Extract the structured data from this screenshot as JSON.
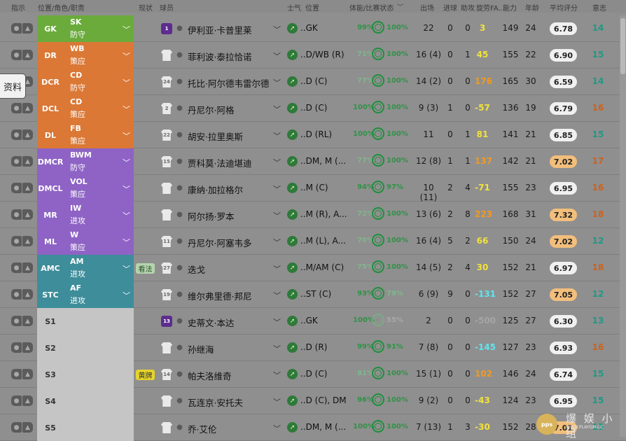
{
  "header": {
    "instruction": "指示",
    "position_role_duty": "位置/角色/职责",
    "status": "现状",
    "player": "球员",
    "morale": "士气",
    "position": "位置",
    "condition_sharpness": "体能/比赛状态",
    "apps": "出场",
    "goals": "进球",
    "assists": "助攻",
    "pom": "旋劳FA...",
    "ability": "能力",
    "age": "年龄",
    "avg_rating": "平均评分",
    "intent": "意志"
  },
  "side_button": "资料",
  "colors": {
    "gk": "#6aab3c",
    "defence": "#db7835",
    "midfield": "#8e63c5",
    "attack": "#3d8d9a",
    "sub": "#c5c5c5",
    "green_condition": "#2f9346",
    "orange": "#f09a23",
    "yellow": "#f2e23b",
    "cyan": "#5fe6f2",
    "intent_teal": "#1c9a86",
    "intent_orange": "#d0611a"
  },
  "rows": [
    {
      "pos": "GK",
      "role": "SK",
      "duty": "防守",
      "group": "gk",
      "tag": "",
      "shirt": "1",
      "shirt_style": "purple",
      "name": "伊利亚·卡普里莱",
      "mpos": "..GK",
      "cond": "99%",
      "cond_color": "green",
      "sharp": "100%",
      "sharp_color": "green",
      "apps": "22",
      "goals": "0",
      "assists": "0",
      "pom": "3",
      "pom_color": "yellow",
      "ability": "149",
      "age": "24",
      "rating": "6.78",
      "rating_hi": false,
      "intent": "14",
      "intent_color": "teal"
    },
    {
      "pos": "DR",
      "role": "WB",
      "duty": "策应",
      "group": "defence",
      "tag": "",
      "shirt": "",
      "shirt_style": "white",
      "name": "菲利波·泰拉恰诺",
      "mpos": "..D/WB (R)",
      "cond": "71%",
      "cond_color": "green-light",
      "sharp": "100%",
      "sharp_color": "green",
      "apps": "16 (4)",
      "goals": "0",
      "assists": "1",
      "pom": "45",
      "pom_color": "yellow",
      "ability": "155",
      "age": "22",
      "rating": "6.90",
      "rating_hi": false,
      "intent": "15",
      "intent_color": "teal"
    },
    {
      "pos": "DCR",
      "role": "CD",
      "duty": "防守",
      "group": "defence",
      "tag": "",
      "shirt": "24",
      "shirt_style": "white",
      "name": "托比·阿尔德韦雷尔德",
      "mpos": "..D (C)",
      "cond": "77%",
      "cond_color": "green-light",
      "sharp": "100%",
      "sharp_color": "green",
      "apps": "14 (2)",
      "goals": "0",
      "assists": "0",
      "pom": "176",
      "pom_color": "orange",
      "ability": "165",
      "age": "30",
      "rating": "6.59",
      "rating_hi": false,
      "intent": "14",
      "intent_color": "teal"
    },
    {
      "pos": "DCL",
      "role": "CD",
      "duty": "策应",
      "group": "defence",
      "tag": "",
      "shirt": "2",
      "shirt_style": "white",
      "name": "丹尼尔·阿格",
      "mpos": "..D (C)",
      "cond": "100%",
      "cond_color": "green",
      "sharp": "100%",
      "sharp_color": "green",
      "apps": "9 (3)",
      "goals": "1",
      "assists": "0",
      "pom": "-57",
      "pom_color": "yellow",
      "ability": "136",
      "age": "19",
      "rating": "6.79",
      "rating_hi": false,
      "intent": "16",
      "intent_color": "orange"
    },
    {
      "pos": "DL",
      "role": "FB",
      "duty": "策应",
      "group": "defence",
      "tag": "",
      "shirt": "22",
      "shirt_style": "white",
      "name": "胡安·拉里奥斯",
      "mpos": "..D (RL)",
      "cond": "100%",
      "cond_color": "green",
      "sharp": "100%",
      "sharp_color": "green",
      "apps": "11",
      "goals": "0",
      "assists": "1",
      "pom": "81",
      "pom_color": "yellow",
      "ability": "141",
      "age": "21",
      "rating": "6.85",
      "rating_hi": false,
      "intent": "15",
      "intent_color": "teal"
    },
    {
      "pos": "DMCR",
      "role": "BWM",
      "duty": "防守",
      "group": "midfield",
      "tag": "",
      "shirt": "15",
      "shirt_style": "white",
      "name": "贾科莫·法迪堪迪",
      "mpos": "..DM, M (...",
      "cond": "77%",
      "cond_color": "green-light",
      "sharp": "100%",
      "sharp_color": "green",
      "apps": "12 (8)",
      "goals": "1",
      "assists": "1",
      "pom": "137",
      "pom_color": "orange",
      "ability": "142",
      "age": "21",
      "rating": "7.02",
      "rating_hi": true,
      "intent": "17",
      "intent_color": "orange"
    },
    {
      "pos": "DMCL",
      "role": "VOL",
      "duty": "策应",
      "group": "midfield",
      "tag": "",
      "shirt": "",
      "shirt_style": "white",
      "name": "康纳·加拉格尔",
      "mpos": "..M (C)",
      "cond": "94%",
      "cond_color": "green",
      "sharp": "97%",
      "sharp_color": "green",
      "apps": "10 (11)",
      "goals": "2",
      "assists": "4",
      "pom": "-71",
      "pom_color": "yellow",
      "ability": "155",
      "age": "23",
      "rating": "6.95",
      "rating_hi": false,
      "intent": "16",
      "intent_color": "orange"
    },
    {
      "pos": "MR",
      "role": "IW",
      "duty": "进攻",
      "group": "midfield",
      "tag": "",
      "shirt": "",
      "shirt_style": "white",
      "name": "阿尔扬·罗本",
      "mpos": "..M (R), A...",
      "cond": "72%",
      "cond_color": "green-light",
      "sharp": "100%",
      "sharp_color": "green",
      "apps": "13 (6)",
      "goals": "2",
      "assists": "8",
      "pom": "223",
      "pom_color": "orange",
      "ability": "168",
      "age": "31",
      "rating": "7.32",
      "rating_hi": true,
      "intent": "18",
      "intent_color": "orange"
    },
    {
      "pos": "ML",
      "role": "W",
      "duty": "策应",
      "group": "midfield",
      "tag": "",
      "shirt": "11",
      "shirt_style": "white",
      "name": "丹尼尔·阿塞韦多",
      "mpos": "..M (L), A...",
      "cond": "70%",
      "cond_color": "green-light",
      "sharp": "100%",
      "sharp_color": "green",
      "apps": "16 (4)",
      "goals": "5",
      "assists": "2",
      "pom": "66",
      "pom_color": "yellow",
      "ability": "150",
      "age": "24",
      "rating": "7.02",
      "rating_hi": true,
      "intent": "12",
      "intent_color": "teal"
    },
    {
      "pos": "AMC",
      "role": "AM",
      "duty": "进攻",
      "group": "attack",
      "tag": "看法",
      "tag_style": "green",
      "shirt": "27",
      "shirt_style": "white",
      "name": "迭戈",
      "mpos": "..M/AM (C)",
      "cond": "75%",
      "cond_color": "green-light",
      "sharp": "100%",
      "sharp_color": "green",
      "apps": "14 (5)",
      "goals": "2",
      "assists": "4",
      "pom": "30",
      "pom_color": "yellow",
      "ability": "152",
      "age": "21",
      "rating": "6.97",
      "rating_hi": false,
      "intent": "18",
      "intent_color": "orange"
    },
    {
      "pos": "STC",
      "role": "AF",
      "duty": "进攻",
      "group": "attack",
      "tag": "",
      "shirt": "19",
      "shirt_style": "white",
      "name": "维尔弗里德·邦尼",
      "mpos": "..ST (C)",
      "cond": "93%",
      "cond_color": "green",
      "sharp": "79%",
      "sharp_color": "green-light",
      "apps": "6 (9)",
      "goals": "9",
      "assists": "0",
      "pom": "-131",
      "pom_color": "cyan",
      "ability": "152",
      "age": "27",
      "rating": "7.05",
      "rating_hi": true,
      "intent": "12",
      "intent_color": "teal"
    },
    {
      "pos": "S1",
      "role": "",
      "duty": "",
      "group": "sub",
      "tag": "",
      "shirt": "13",
      "shirt_style": "purple",
      "name": "史蒂文·本达",
      "mpos": "..GK",
      "cond": "100%",
      "cond_color": "green",
      "sharp": "55%",
      "sharp_color": "faint",
      "apps": "2",
      "goals": "0",
      "assists": "0",
      "pom": "-500",
      "pom_color": "faint",
      "ability": "125",
      "age": "27",
      "rating": "6.30",
      "rating_hi": false,
      "intent": "13",
      "intent_color": "teal"
    },
    {
      "pos": "S2",
      "role": "",
      "duty": "",
      "group": "sub",
      "tag": "",
      "shirt": "",
      "shirt_style": "white",
      "name": "孙继海",
      "mpos": "..D (R)",
      "cond": "99%",
      "cond_color": "green",
      "sharp": "91%",
      "sharp_color": "green",
      "apps": "7 (8)",
      "goals": "0",
      "assists": "0",
      "pom": "-145",
      "pom_color": "cyan",
      "ability": "127",
      "age": "23",
      "rating": "6.93",
      "rating_hi": false,
      "intent": "16",
      "intent_color": "orange"
    },
    {
      "pos": "S3",
      "role": "",
      "duty": "",
      "group": "sub",
      "tag": "黄牌",
      "tag_style": "yellow",
      "shirt": "14",
      "shirt_style": "white",
      "name": "帕夫洛维奇",
      "mpos": "..D (C)",
      "cond": "81%",
      "cond_color": "green-light",
      "sharp": "100%",
      "sharp_color": "green",
      "apps": "15 (1)",
      "goals": "0",
      "assists": "0",
      "pom": "102",
      "pom_color": "orange",
      "ability": "146",
      "age": "24",
      "rating": "6.74",
      "rating_hi": false,
      "intent": "15",
      "intent_color": "teal"
    },
    {
      "pos": "S4",
      "role": "",
      "duty": "",
      "group": "sub",
      "tag": "",
      "shirt": "",
      "shirt_style": "white",
      "name": "瓦连京·安托夫",
      "mpos": "..D (C), DM",
      "cond": "96%",
      "cond_color": "green",
      "sharp": "100%",
      "sharp_color": "green",
      "apps": "9 (2)",
      "goals": "0",
      "assists": "0",
      "pom": "-43",
      "pom_color": "yellow",
      "ability": "124",
      "age": "23",
      "rating": "6.95",
      "rating_hi": false,
      "intent": "15",
      "intent_color": "teal"
    },
    {
      "pos": "S5",
      "role": "",
      "duty": "",
      "group": "sub",
      "tag": "",
      "shirt": "",
      "shirt_style": "white",
      "name": "乔·艾伦",
      "mpos": "..DM, M (...",
      "cond": "100%",
      "cond_color": "green",
      "sharp": "100%",
      "sharp_color": "green",
      "apps": "7 (13)",
      "goals": "1",
      "assists": "3",
      "pom": "-30",
      "pom_color": "yellow",
      "ability": "152",
      "age": "28",
      "rating": "7.01",
      "rating_hi": true,
      "intent": "15",
      "intent_color": "teal"
    }
  ],
  "watermark": {
    "icon": "pps",
    "main": "爆 娱 小 组",
    "sub": "WWW.PLAYGM.CC"
  }
}
